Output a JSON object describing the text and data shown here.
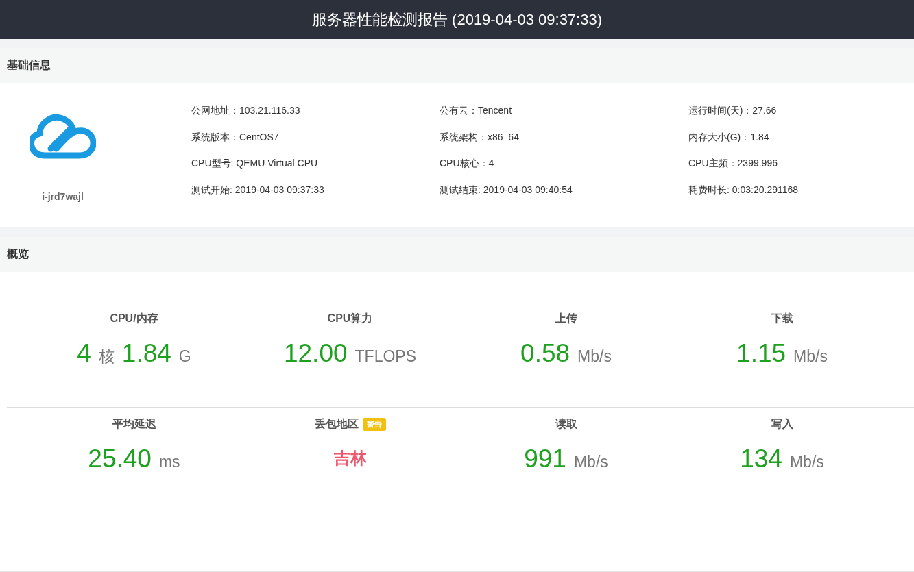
{
  "header": {
    "title": "服务器性能检测报告 (2019-04-03 09:37:33)"
  },
  "basic": {
    "title": "基础信息",
    "instance": "i-jrd7wajl",
    "fields": [
      {
        "text": "公网地址：103.21.116.33"
      },
      {
        "text": "公有云：Tencent"
      },
      {
        "text": "运行时间(天)：27.66"
      },
      {
        "text": "系统版本：CentOS7"
      },
      {
        "text": "系统架构：x86_64"
      },
      {
        "text": "内存大小(G)：1.84"
      },
      {
        "text": "CPU型号: QEMU Virtual CPU"
      },
      {
        "text": "CPU核心：4"
      },
      {
        "text": "CPU主频：2399.996"
      },
      {
        "text": "测试开始: 2019-04-03 09:37:33"
      },
      {
        "text": "测试结束: 2019-04-03 09:40:54"
      },
      {
        "text": "耗费时长: 0:03:20.291168"
      }
    ]
  },
  "overview": {
    "title": "概览",
    "rows": [
      [
        {
          "label": "CPU/内存",
          "parts": [
            {
              "kind": "number",
              "text": "4"
            },
            {
              "kind": "unit",
              "text": "核"
            },
            {
              "kind": "number",
              "text": "1.84"
            },
            {
              "kind": "unit",
              "text": "G"
            }
          ]
        },
        {
          "label": "CPU算力",
          "parts": [
            {
              "kind": "number",
              "text": "12.00"
            },
            {
              "kind": "unit",
              "text": "TFLOPS"
            }
          ]
        },
        {
          "label": "上传",
          "parts": [
            {
              "kind": "number",
              "text": "0.58"
            },
            {
              "kind": "unit",
              "text": "Mb/s"
            }
          ]
        },
        {
          "label": "下载",
          "parts": [
            {
              "kind": "number",
              "text": "1.15"
            },
            {
              "kind": "unit",
              "text": "Mb/s"
            }
          ]
        }
      ],
      [
        {
          "label": "平均延迟",
          "parts": [
            {
              "kind": "number",
              "text": "25.40"
            },
            {
              "kind": "unit",
              "text": "ms"
            }
          ]
        },
        {
          "label": "丢包地区",
          "badge": "警告",
          "parts": [
            {
              "kind": "alert",
              "text": "吉林"
            }
          ]
        },
        {
          "label": "读取",
          "parts": [
            {
              "kind": "number",
              "text": "991"
            },
            {
              "kind": "unit",
              "text": "Mb/s"
            }
          ]
        },
        {
          "label": "写入",
          "parts": [
            {
              "kind": "number",
              "text": "134"
            },
            {
              "kind": "unit",
              "text": "Mb/s"
            }
          ]
        }
      ]
    ]
  }
}
